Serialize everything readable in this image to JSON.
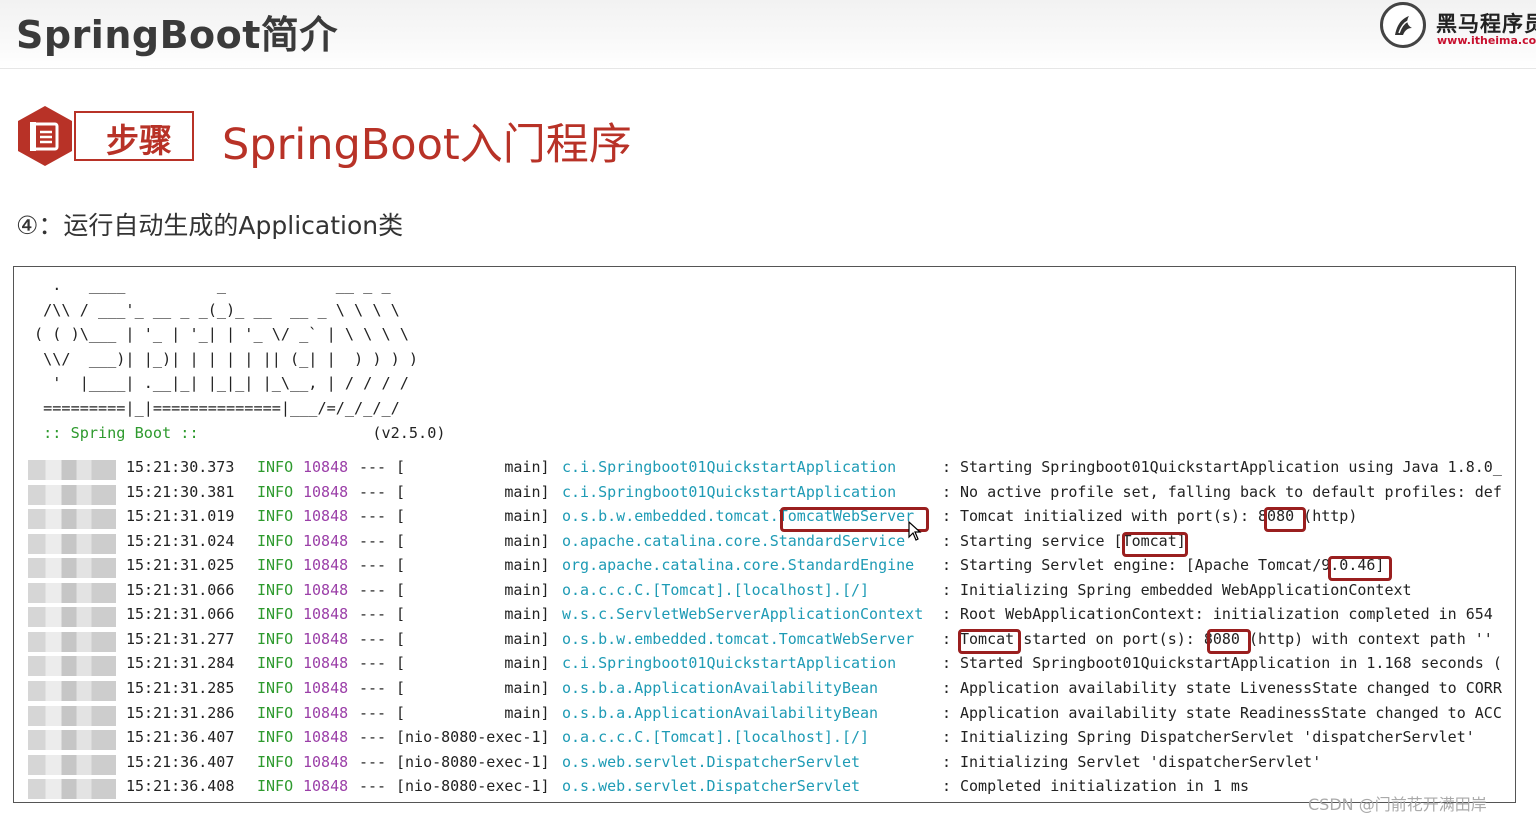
{
  "header": {
    "title": "SpringBoot简介",
    "logo_cn": "黑马程序员",
    "logo_url": "www.itheima.com"
  },
  "step": {
    "badge": "步骤",
    "section_title": "SpringBoot入门程序",
    "substep": "④：运行自动生成的Application类"
  },
  "banner": {
    "lines": [
      "  .   ____          _            __ _ _",
      " /\\\\ / ___'_ __ _ _(_)_ __  __ _ \\ \\ \\ \\",
      "( ( )\\___ | '_ | '_| | '_ \\/ _` | \\ \\ \\ \\",
      " \\\\/  ___)| |_)| | | | | || (_| |  ) ) ) )",
      "  '  |____| .__|_| |_|_| |_\\__, | / / / /",
      " =========|_|==============|___/=/_/_/_/"
    ],
    "spring_label": " :: Spring Boot ::",
    "version": "(v2.5.0)"
  },
  "log": {
    "level": "INFO",
    "pid": "10848",
    "separator": "---",
    "rows": [
      {
        "time": "15:21:30.373",
        "thread": "[           main]",
        "logger": "c.i.Springboot01QuickstartApplication",
        "msg": "Starting Springboot01QuickstartApplication using Java 1.8.0_"
      },
      {
        "time": "15:21:30.381",
        "thread": "[           main]",
        "logger": "c.i.Springboot01QuickstartApplication",
        "msg": "No active profile set, falling back to default profiles: def"
      },
      {
        "time": "15:21:31.019",
        "thread": "[           main]",
        "logger": "o.s.b.w.embedded.tomcat.TomcatWebServer",
        "msg": "Tomcat initialized with port(s): 8080 (http)"
      },
      {
        "time": "15:21:31.024",
        "thread": "[           main]",
        "logger": "o.apache.catalina.core.StandardService",
        "msg": "Starting service [Tomcat]"
      },
      {
        "time": "15:21:31.025",
        "thread": "[           main]",
        "logger": "org.apache.catalina.core.StandardEngine",
        "msg": "Starting Servlet engine: [Apache Tomcat/9.0.46]"
      },
      {
        "time": "15:21:31.066",
        "thread": "[           main]",
        "logger": "o.a.c.c.C.[Tomcat].[localhost].[/]",
        "msg": "Initializing Spring embedded WebApplicationContext"
      },
      {
        "time": "15:21:31.066",
        "thread": "[           main]",
        "logger": "w.s.c.ServletWebServerApplicationContext",
        "msg": "Root WebApplicationContext: initialization completed in 654"
      },
      {
        "time": "15:21:31.277",
        "thread": "[           main]",
        "logger": "o.s.b.w.embedded.tomcat.TomcatWebServer",
        "msg": "Tomcat started on port(s): 8080 (http) with context path ''"
      },
      {
        "time": "15:21:31.284",
        "thread": "[           main]",
        "logger": "c.i.Springboot01QuickstartApplication",
        "msg": "Started Springboot01QuickstartApplication in 1.168 seconds ("
      },
      {
        "time": "15:21:31.285",
        "thread": "[           main]",
        "logger": "o.s.b.a.ApplicationAvailabilityBean",
        "msg": "Application availability state LivenessState changed to CORR"
      },
      {
        "time": "15:21:31.286",
        "thread": "[           main]",
        "logger": "o.s.b.a.ApplicationAvailabilityBean",
        "msg": "Application availability state ReadinessState changed to ACC"
      },
      {
        "time": "15:21:36.407",
        "thread": "[nio-8080-exec-1]",
        "logger": "o.a.c.c.C.[Tomcat].[localhost].[/]",
        "msg": "Initializing Spring DispatcherServlet 'dispatcherServlet'"
      },
      {
        "time": "15:21:36.407",
        "thread": "[nio-8080-exec-1]",
        "logger": "o.s.web.servlet.DispatcherServlet",
        "msg": "Initializing Servlet 'dispatcherServlet'"
      },
      {
        "time": "15:21:36.408",
        "thread": "[nio-8080-exec-1]",
        "logger": "o.s.web.servlet.DispatcherServlet",
        "msg": "Completed initialization in 1 ms"
      }
    ]
  },
  "watermark": "CSDN @门前花开满田岸",
  "colors": {
    "accent_red": "#b83227",
    "highlight_border": "#9a1f1f",
    "info_green": "#2e9a2e",
    "pid_purple": "#9b3fa8",
    "logger_cyan": "#1e9bb5"
  }
}
